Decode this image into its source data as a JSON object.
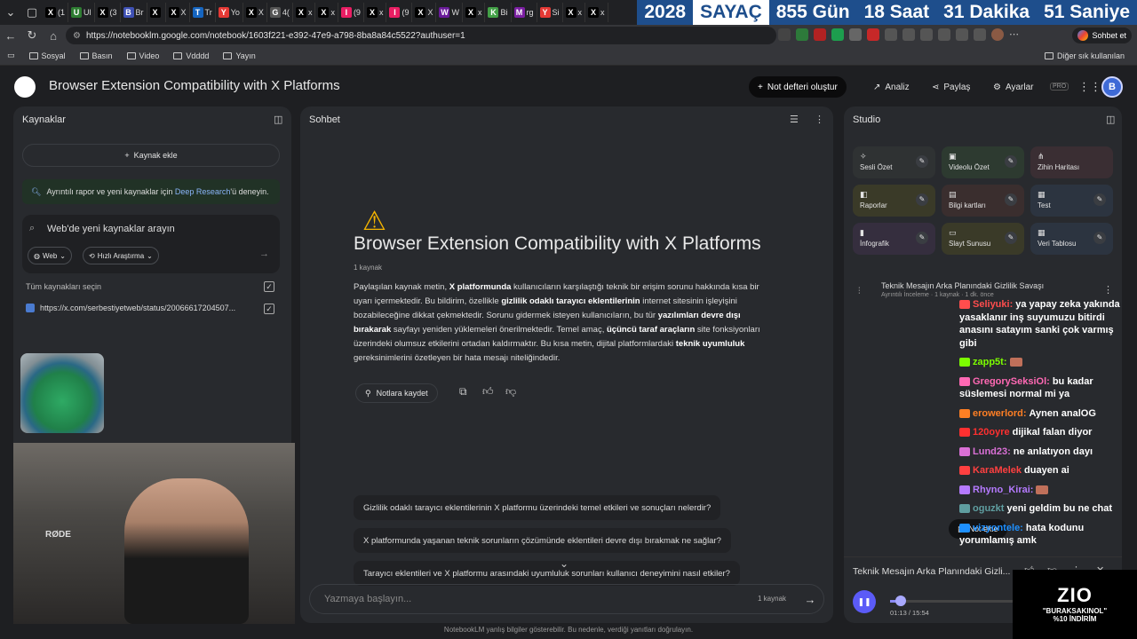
{
  "browser": {
    "tabs": [
      {
        "icon": "X",
        "label": "(1"
      },
      {
        "icon": "U",
        "label": "Ul"
      },
      {
        "icon": "X",
        "label": "(3"
      },
      {
        "icon": "B",
        "label": "Br"
      },
      {
        "icon": "X",
        "label": ""
      },
      {
        "icon": "X",
        "label": "X"
      },
      {
        "icon": "T",
        "label": "Tr"
      },
      {
        "icon": "Y",
        "label": "Yo"
      },
      {
        "icon": "X",
        "label": "X"
      },
      {
        "icon": "G",
        "label": "4("
      },
      {
        "icon": "X",
        "label": "x"
      },
      {
        "icon": "X",
        "label": "x"
      },
      {
        "icon": "I",
        "label": "(9"
      },
      {
        "icon": "X",
        "label": "x"
      },
      {
        "icon": "I",
        "label": "(9"
      },
      {
        "icon": "X",
        "label": "X"
      },
      {
        "icon": "W",
        "label": "W"
      },
      {
        "icon": "X",
        "label": "x"
      },
      {
        "icon": "K",
        "label": "Bi"
      },
      {
        "icon": "M",
        "label": "rg"
      },
      {
        "icon": "Y",
        "label": "Si"
      },
      {
        "icon": "X",
        "label": "x"
      },
      {
        "icon": "X",
        "label": "x"
      }
    ],
    "url": "https://notebooklm.google.com/notebook/1603f221-e392-47e9-a798-8ba8a84c5522?authuser=1",
    "gemini_label": "Sohbet et",
    "bookmarks": [
      "Sosyal",
      "Basın",
      "Video",
      "Vdddd",
      "Yayın"
    ],
    "other_bookmarks": "Diğer sık kullanılan"
  },
  "countdown": {
    "year": "2028",
    "label": "SAYAÇ",
    "days": "855 Gün",
    "hours": "18 Saat",
    "minutes": "31 Dakika",
    "seconds": "51 Saniye"
  },
  "header": {
    "title": "Browser Extension Compatibility with X Platforms",
    "create_label": "Not defteri oluştur",
    "analyze_label": "Analiz",
    "share_label": "Paylaş",
    "settings_label": "Ayarlar",
    "pro_badge": "PRO",
    "avatar_letter": "B"
  },
  "sources": {
    "title": "Kaynaklar",
    "add_label": "Kaynak ekle",
    "deep_research_prefix": "Ayrıntılı rapor ve yeni kaynaklar için ",
    "deep_research_link": "Deep Research",
    "deep_research_suffix": "'ü deneyin.",
    "search_placeholder": "Web'de yeni kaynaklar arayın",
    "chip_web": "Web",
    "chip_fast": "Hızlı Araştırma",
    "select_all": "Tüm kaynakları seçin",
    "items": [
      {
        "title": "https://x.com/serbestiyetweb/status/20066617204507..."
      }
    ],
    "webcam_brand": "RØDE"
  },
  "chat": {
    "title": "Sohbet",
    "notebook_title": "Browser Extension Compatibility with X Platforms",
    "source_count": "1 kaynak",
    "summary": [
      {
        "t": "Paylaşılan kaynak metin, ",
        "b": false
      },
      {
        "t": "X platformunda",
        "b": true
      },
      {
        "t": " kullanıcıların karşılaştığı teknik bir erişim sorunu hakkında kısa bir uyarı içermektedir. Bu bildirim, özellikle ",
        "b": false
      },
      {
        "t": "gizlilik odaklı tarayıcı eklentilerinin",
        "b": true
      },
      {
        "t": " internet sitesinin işleyişini bozabileceğine dikkat çekmektedir. Sorunu gidermek isteyen kullanıcıların, bu tür ",
        "b": false
      },
      {
        "t": "yazılımları devre dışı bırakarak",
        "b": true
      },
      {
        "t": " sayfayı yeniden yüklemeleri önerilmektedir. Temel amaç, ",
        "b": false
      },
      {
        "t": "üçüncü taraf araçların",
        "b": true
      },
      {
        "t": " site fonksiyonları üzerindeki olumsuz etkilerini ortadan kaldırmaktır. Bu kısa metin, dijital platformlardaki ",
        "b": false
      },
      {
        "t": "teknik uyumluluk",
        "b": true
      },
      {
        "t": " gereksinimlerini özetleyen bir hata mesajı niteliğindedir.",
        "b": false
      }
    ],
    "save_note_label": "Notlara kaydet",
    "suggestions": [
      "Gizlilik odaklı tarayıcı eklentilerinin X platformu üzerindeki temel etkileri ve sonuçları nelerdir?",
      "X platformunda yaşanan teknik sorunların çözümünde eklentileri devre dışı bırakmak ne sağlar?",
      "Tarayıcı eklentileri ve X platformu arasındaki uyumluluk sorunları kullanıcı deneyimini nasıl etkiler?"
    ],
    "input_placeholder": "Yazmaya başlayın...",
    "input_source_count": "1 kaynak"
  },
  "studio": {
    "title": "Studio",
    "tiles": [
      {
        "label": "Sesli Özet",
        "icon": "✧",
        "color": "#2f3233"
      },
      {
        "label": "Videolu Özet",
        "icon": "▣",
        "color": "#2d3a30"
      },
      {
        "label": "Zihin Haritası",
        "icon": "⋔",
        "color": "#3a2e33"
      },
      {
        "label": "Raporlar",
        "icon": "◧",
        "color": "#3a3a28"
      },
      {
        "label": "Bilgi kartları",
        "icon": "▤",
        "color": "#3a2e2e"
      },
      {
        "label": "Test",
        "icon": "▦",
        "color": "#2c3440"
      },
      {
        "label": "İnfografik",
        "icon": "▮",
        "color": "#352e3e"
      },
      {
        "label": "Slayt Sunusu",
        "icon": "▭",
        "color": "#3a3a28"
      },
      {
        "label": "Veri Tablosu",
        "icon": "▦",
        "color": "#2c3440"
      }
    ],
    "audio_title": "Teknik Mesajın Arka Planındaki Gizlilik Savaşı",
    "audio_meta": "Ayrıntılı İnceleme · 1 kaynak · 1 dk. önce",
    "add_note_label": "Not ekle",
    "player": {
      "title": "Teknik Mesajın Arka Planındaki Gizli...",
      "time": "01:13 / 15:54",
      "progress": 0.077
    }
  },
  "stream_chat": [
    {
      "user": "Seliyuki:",
      "color": "#ff4d4d",
      "text": "ya yapay zeka yakında yasaklanır inş suyumuzu bitirdi anasını satayım sanki çok varmış gibi"
    },
    {
      "user": "zapp5t:",
      "color": "#7cfc00",
      "text": ""
    },
    {
      "user": "GregorySeksiOl:",
      "color": "#ff69b4",
      "text": "bu kadar süslemesi normal mi ya"
    },
    {
      "user": "erowerlord:",
      "color": "#ff7f24",
      "text": "Aynen anal​OG"
    },
    {
      "user": "120oyre",
      "color": "#ff3030",
      "text": "dijikal falan diyor"
    },
    {
      "user": "Lund23:",
      "color": "#da70d6",
      "text": "ne anlatıyon dayı"
    },
    {
      "user": "KaraMelek",
      "color": "#ff4040",
      "text": "duayen ai"
    },
    {
      "user": "Rhyno_Kirai:",
      "color": "#b57aff",
      "text": ""
    },
    {
      "user": "oguzkt",
      "color": "#5f9ea0",
      "text": "yeni geldim bu ne chat"
    },
    {
      "user": "vizyontele:",
      "color": "#1e90ff",
      "text": "hata kodunu yorumlamış amk"
    }
  ],
  "sponsor": {
    "logo": "ZIO",
    "code": "\"BURAKSAKINOL\"",
    "discount": "%10 İNDİRİM"
  },
  "footer": "NotebookLM yanlış bilgiler gösterebilir. Bu nedenle, verdiği yanıtları doğrulayın."
}
